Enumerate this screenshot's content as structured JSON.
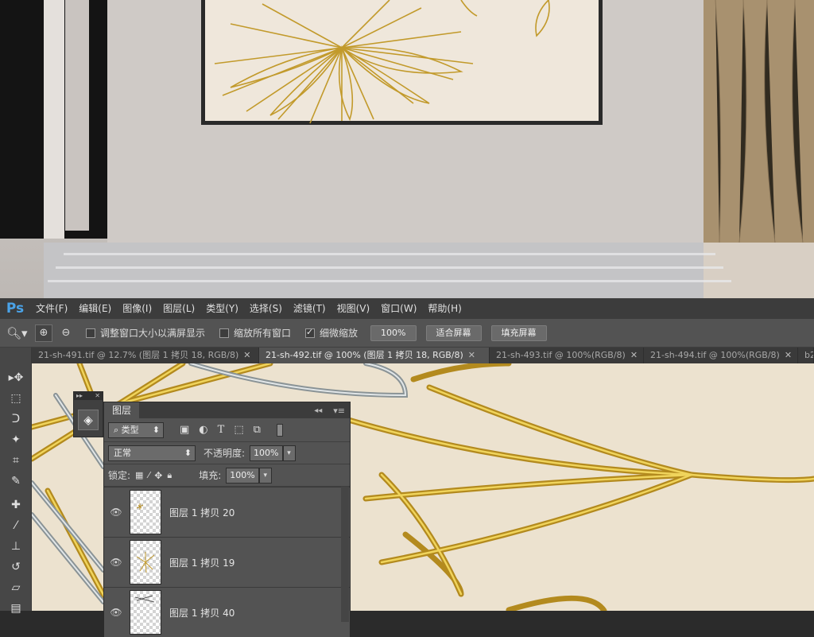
{
  "menubar": {
    "logo": "Ps",
    "items": [
      "文件(F)",
      "编辑(E)",
      "图像(I)",
      "图层(L)",
      "类型(Y)",
      "选择(S)",
      "滤镜(T)",
      "视图(V)",
      "窗口(W)",
      "帮助(H)"
    ]
  },
  "options_bar": {
    "resize_windows_label": "调整窗口大小以满屏显示",
    "zoom_all_label": "缩放所有窗口",
    "scrubby_zoom_label": "细微缩放",
    "zoom_value": "100%",
    "fit_screen_label": "适合屏幕",
    "fill_screen_label": "填充屏幕",
    "resize_windows_checked": false,
    "zoom_all_checked": false,
    "scrubby_zoom_checked": true
  },
  "tabs": [
    {
      "label": "21-sh-491.tif @ 12.7% (图层 1 拷贝 18, RGB/8)",
      "active": false
    },
    {
      "label": "21-sh-492.tif @ 100% (图层 1 拷贝 18, RGB/8)",
      "active": true
    },
    {
      "label": "21-sh-493.tif @ 100%(RGB/8)",
      "active": false
    },
    {
      "label": "21-sh-494.tif @ 100%(RGB/8)",
      "active": false
    },
    {
      "label": "b2.",
      "active": false
    }
  ],
  "tools": [
    "move-icon",
    "marquee-icon",
    "lasso-icon",
    "magic-wand-icon",
    "crop-icon",
    "eyedropper-icon",
    "healing-brush-icon",
    "brush-icon",
    "clone-stamp-icon",
    "history-brush-icon",
    "eraser-icon",
    "gradient-icon"
  ],
  "layers_panel": {
    "title": "图层",
    "filter_kind": "类型",
    "blend_mode": "正常",
    "opacity_label": "不透明度:",
    "opacity_value": "100%",
    "lock_label": "锁定:",
    "fill_label": "填充:",
    "fill_value": "100%",
    "layers": [
      {
        "name": "图层 1 拷贝 20",
        "visible": true
      },
      {
        "name": "图层 1 拷贝 19",
        "visible": true
      },
      {
        "name": "图层 1 拷贝 40",
        "visible": true
      }
    ]
  },
  "colors": {
    "ui_dark": "#535353",
    "menubar": "#3c3c3c",
    "ps_blue": "#4aa3e8",
    "gold": "#c9a227",
    "canvas_bg": "#ece2cf"
  }
}
